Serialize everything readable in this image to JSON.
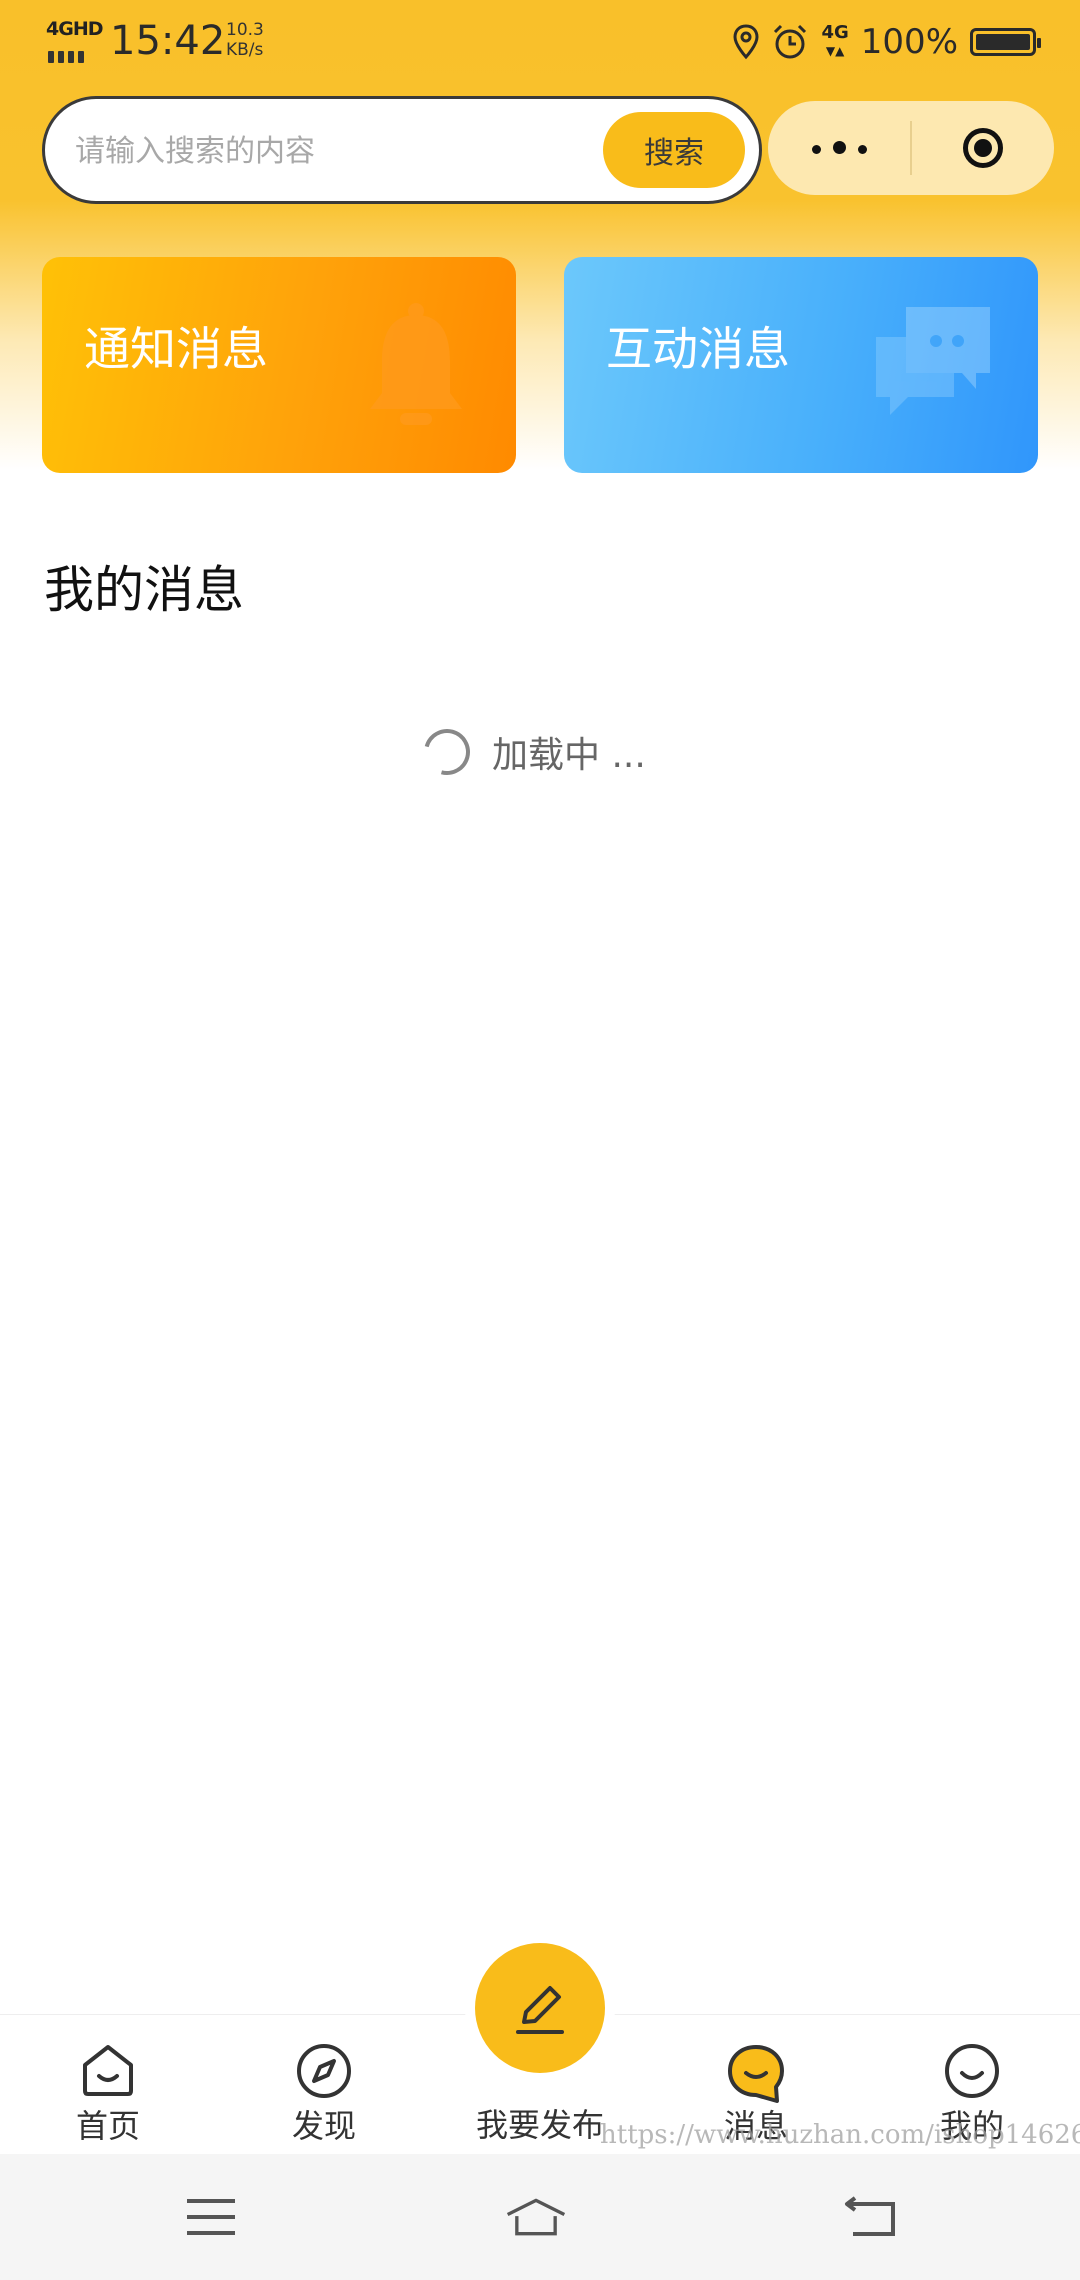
{
  "status_bar": {
    "network": "4GHD",
    "time": "15:42",
    "speed_value": "10.3",
    "speed_unit": "KB/s",
    "secondary_network": "4G",
    "battery": "100%"
  },
  "search": {
    "placeholder": "请输入搜索的内容",
    "button_label": "搜索"
  },
  "cards": {
    "notice": {
      "label": "通知消息",
      "icon": "bell-icon",
      "color_start": "#ffc107",
      "color_end": "#ff8a00"
    },
    "interact": {
      "label": "互动消息",
      "icon": "chat-bubbles-icon",
      "color_start": "#6cc8fb",
      "color_end": "#3096fb"
    }
  },
  "section": {
    "title": "我的消息"
  },
  "loading": {
    "text": "加载中 ..."
  },
  "tabbar": {
    "items": [
      {
        "label": "首页",
        "icon": "home-icon",
        "active": false
      },
      {
        "label": "发现",
        "icon": "compass-icon",
        "active": false
      },
      {
        "label": "我要发布",
        "icon": "pencil-icon",
        "active": false
      },
      {
        "label": "消息",
        "icon": "message-smile-icon",
        "active": true
      },
      {
        "label": "我的",
        "icon": "smile-icon",
        "active": false
      }
    ],
    "accent_color": "#f9bc1a"
  },
  "watermark": "https://www.huzhan.com/ishop14626",
  "system_nav": {
    "icons": [
      "menu-icon",
      "home-icon",
      "back-icon"
    ]
  }
}
